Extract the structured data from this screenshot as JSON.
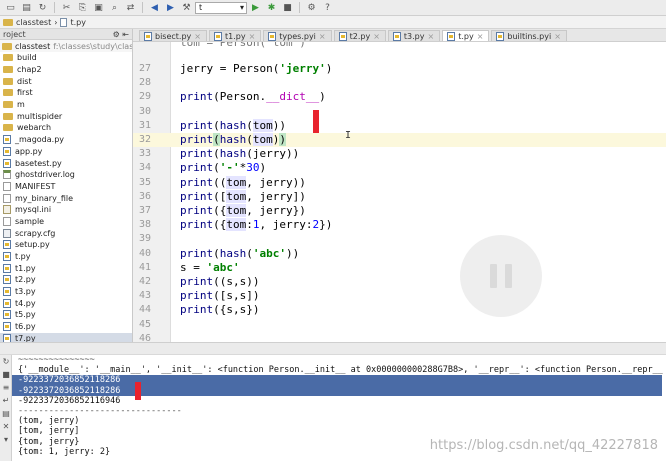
{
  "toolbar": {
    "buttons": [
      "open-icon",
      "save-icon",
      "refresh-icon",
      "cut-icon",
      "copy-icon",
      "paste-icon",
      "find-icon",
      "replace-icon",
      "back-icon",
      "forward-icon",
      "build-icon"
    ],
    "run_config": "t",
    "run_buttons": [
      "run-icon",
      "debug-icon",
      "stop-icon",
      "settings-icon",
      "help-icon"
    ]
  },
  "navbar": {
    "project": "classtest",
    "file": "t.py"
  },
  "project_panel": {
    "header": "roject",
    "root_name": "classtest",
    "root_path": "f:\\classes\\study\\classtest",
    "items": [
      {
        "label": "build",
        "icon": "folder"
      },
      {
        "label": "chap2",
        "icon": "folder"
      },
      {
        "label": "dist",
        "icon": "folder"
      },
      {
        "label": "first",
        "icon": "folder"
      },
      {
        "label": "m",
        "icon": "folder"
      },
      {
        "label": "multispider",
        "icon": "folder"
      },
      {
        "label": "webarch",
        "icon": "folder"
      },
      {
        "label": "_magoda.py",
        "icon": "py"
      },
      {
        "label": "app.py",
        "icon": "py"
      },
      {
        "label": "basetest.py",
        "icon": "py"
      },
      {
        "label": "ghostdriver.log",
        "icon": "log"
      },
      {
        "label": "MANIFEST",
        "icon": "file"
      },
      {
        "label": "my_binary_file",
        "icon": "file"
      },
      {
        "label": "mysql.ini",
        "icon": "ini"
      },
      {
        "label": "sample",
        "icon": "file"
      },
      {
        "label": "scrapy.cfg",
        "icon": "cfg"
      },
      {
        "label": "setup.py",
        "icon": "py"
      },
      {
        "label": "t.py",
        "icon": "py"
      },
      {
        "label": "t1.py",
        "icon": "py"
      },
      {
        "label": "t2.py",
        "icon": "py"
      },
      {
        "label": "t3.py",
        "icon": "py"
      },
      {
        "label": "t4.py",
        "icon": "py"
      },
      {
        "label": "t5.py",
        "icon": "py"
      },
      {
        "label": "t6.py",
        "icon": "py"
      },
      {
        "label": "t7.py",
        "icon": "py"
      }
    ]
  },
  "tabs": [
    {
      "label": "bisect.py",
      "active": false
    },
    {
      "label": "t1.py",
      "active": false
    },
    {
      "label": "types.pyi",
      "active": false
    },
    {
      "label": "t2.py",
      "active": false
    },
    {
      "label": "t3.py",
      "active": false
    },
    {
      "label": "t.py",
      "active": true
    },
    {
      "label": "builtins.pyi",
      "active": false
    }
  ],
  "editor": {
    "top_partial": "tom = Person('tom')",
    "line_numbers": [
      "27",
      "28",
      "29",
      "30",
      "31",
      "32",
      "33",
      "34",
      "35",
      "36",
      "37",
      "38",
      "39",
      "40",
      "41",
      "42",
      "43",
      "44",
      "45",
      "46"
    ],
    "current_line": "32"
  },
  "console": {
    "lines": [
      "~~~~~~~~~~~~~~~",
      "{'__module__': '__main__', '__init__': <function Person.__init__ at 0x000000000288G7B8>, '__repr__': <function Person.__repr__ at",
      "-9223372036852118286",
      "-9223372036852118286",
      "-9223372036852116946",
      "--------------------------------",
      "(tom, jerry)",
      "[tom, jerry]",
      "{tom, jerry}",
      "{tom: 1, jerry: 2}"
    ],
    "selected_lines": [
      2,
      3
    ]
  },
  "watermark": "https://blog.csdn.net/qq_42227818"
}
